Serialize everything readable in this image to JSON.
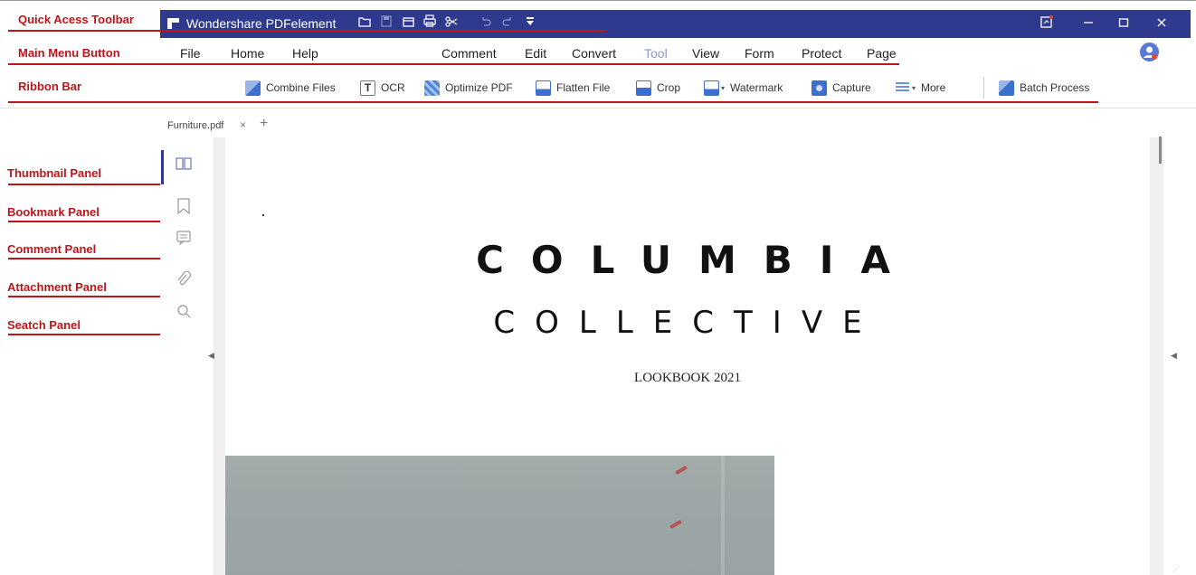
{
  "annotations": [
    {
      "label": "Quick Acess Toolbar"
    },
    {
      "label": "Main Menu Button"
    },
    {
      "label": "Ribbon Bar"
    },
    {
      "label": "Thumbnail Panel"
    },
    {
      "label": "Bookmark Panel"
    },
    {
      "label": "Comment Panel"
    },
    {
      "label": "Attachment Panel"
    },
    {
      "label": "Seatch Panel"
    }
  ],
  "titlebar": {
    "app_title": "Wondershare PDFelement",
    "color": "#2f3a8f",
    "quick_access_icons": [
      "folder-icon",
      "save-icon",
      "mail-icon",
      "print-icon",
      "cut-icon",
      "undo-icon",
      "redo-icon",
      "customize-dropdown-icon"
    ],
    "window_icons": [
      "feedback-icon",
      "minimize-icon",
      "maximize-icon",
      "close-icon"
    ]
  },
  "menu": {
    "items": [
      "File",
      "Home",
      "Help",
      "Comment",
      "Edit",
      "Convert",
      "Tool",
      "View",
      "Form",
      "Protect",
      "Page"
    ],
    "active": "Tool",
    "account_icon": "user-avatar-icon"
  },
  "ribbon": {
    "items": [
      {
        "label": "Combine Files",
        "icon": "combine-files-icon"
      },
      {
        "label": "OCR",
        "icon": "ocr-icon"
      },
      {
        "label": "Optimize PDF",
        "icon": "optimize-pdf-icon"
      },
      {
        "label": "Flatten File",
        "icon": "flatten-file-icon"
      },
      {
        "label": "Crop",
        "icon": "crop-icon"
      },
      {
        "label": "Watermark",
        "icon": "watermark-icon"
      },
      {
        "label": "Capture",
        "icon": "capture-icon"
      },
      {
        "label": "More",
        "icon": "more-icon"
      },
      {
        "label": "Batch Process",
        "icon": "batch-process-icon"
      }
    ]
  },
  "tabs": {
    "items": [
      {
        "label": "Furniture.pdf"
      }
    ],
    "close_glyph": "×",
    "add_glyph": "+"
  },
  "side_panels": [
    "thumbnail-icon",
    "bookmark-icon",
    "comment-icon",
    "attachment-icon",
    "search-icon"
  ],
  "document": {
    "heading": "COLUMBIA",
    "subheading": "COLLECTIVE",
    "caption": "LOOKBOOK 2021"
  }
}
